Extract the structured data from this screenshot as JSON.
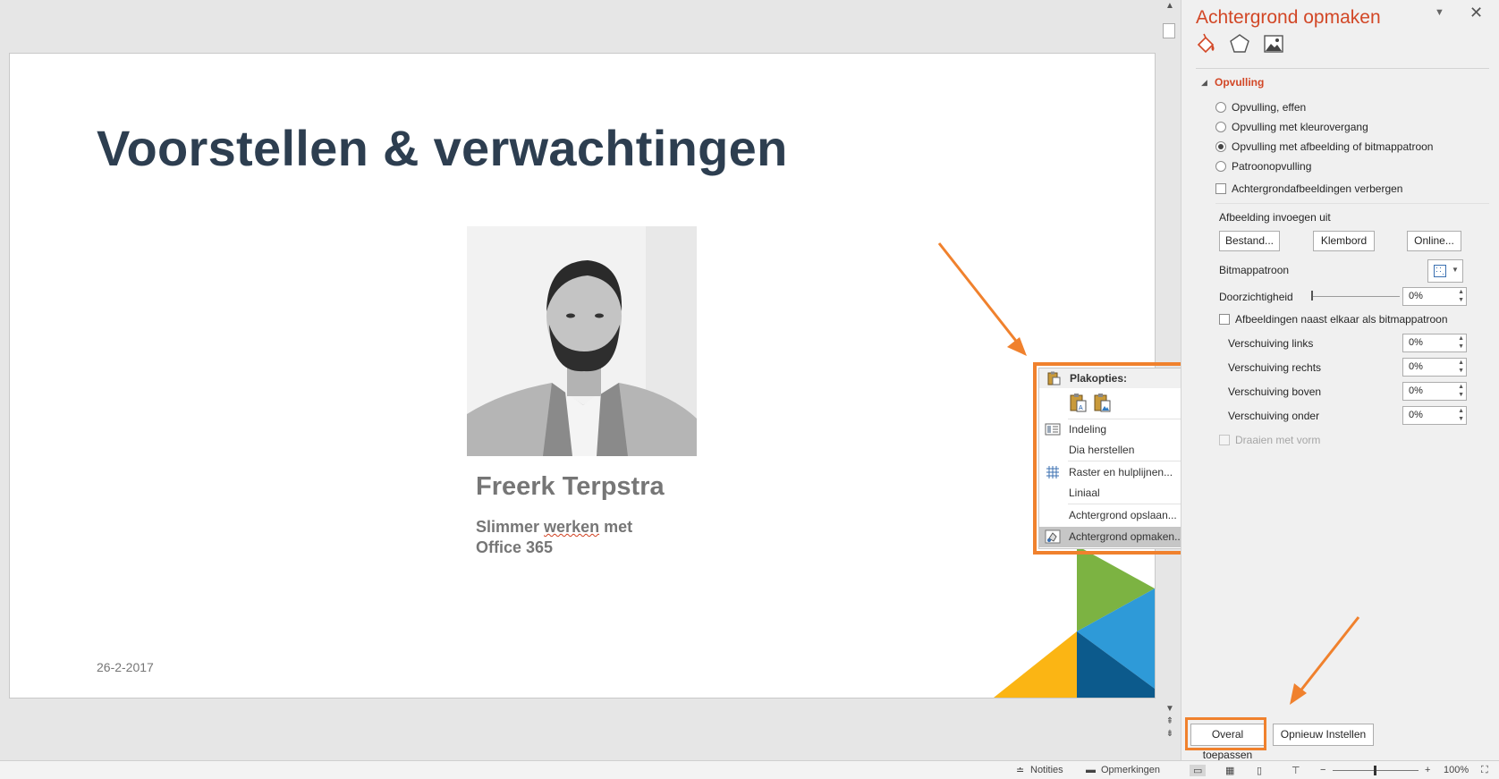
{
  "slide": {
    "title": "Voorstellen & verwachtingen",
    "presenter_name": "Freerk Terpstra",
    "subtitle_line1_a": "Slimmer ",
    "subtitle_line1_b": "werken",
    "subtitle_line1_c": " met",
    "subtitle_line2": "Office 365",
    "date": "26-2-2017"
  },
  "context_menu": {
    "header": "Plakopties:",
    "items": [
      {
        "label": "Indeling",
        "icon": "layout-icon",
        "submenu": true
      },
      {
        "label": "Dia herstellen",
        "icon": "",
        "submenu": false
      },
      {
        "label": "Raster en hulplijnen...",
        "icon": "grid-icon",
        "submenu": true
      },
      {
        "label": "Liniaal",
        "icon": "",
        "submenu": false
      },
      {
        "label": "Achtergrond opslaan...",
        "icon": "",
        "submenu": false
      },
      {
        "label": "Achtergrond opmaken...",
        "icon": "format-background-icon",
        "submenu": false
      }
    ]
  },
  "pane": {
    "title": "Achtergrond opmaken",
    "section": "Opvulling",
    "fill_options": [
      {
        "label": "Opvulling, effen",
        "selected": false
      },
      {
        "label": "Opvulling met kleurovergang",
        "selected": false
      },
      {
        "label": "Opvulling met afbeelding of bitmappatroon",
        "selected": true
      },
      {
        "label": "Patroonopvulling",
        "selected": false
      }
    ],
    "hide_background_graphics": "Achtergrondafbeeldingen verbergen",
    "insert_picture_from": "Afbeelding invoegen uit",
    "btn_file": "Bestand...",
    "btn_clipboard": "Klembord",
    "btn_online": "Online...",
    "bitmap_pattern": "Bitmappatroon",
    "transparency_label": "Doorzichtigheid",
    "transparency_value": "0%",
    "tile_as_texture": "Afbeeldingen naast elkaar als bitmappatroon",
    "offsets": [
      {
        "label": "Verschuiving links",
        "value": "0%"
      },
      {
        "label": "Verschuiving rechts",
        "value": "0%"
      },
      {
        "label": "Verschuiving boven",
        "value": "0%"
      },
      {
        "label": "Verschuiving onder",
        "value": "0%"
      }
    ],
    "rotate_with_shape": "Draaien met vorm",
    "btn_apply_all": "Overal toepassen",
    "btn_reset": "Opnieuw Instellen"
  },
  "statusbar": {
    "notes": "Notities",
    "comments": "Opmerkingen",
    "zoom": "100%"
  },
  "colors": {
    "accent_orange": "#f0812d",
    "pane_title": "#d24726",
    "title_text": "#2d3e50",
    "decor_green": "#7cb342",
    "decor_blue": "#2e9ad8",
    "decor_navy": "#0c5a8c",
    "decor_yellow": "#fbb514"
  }
}
